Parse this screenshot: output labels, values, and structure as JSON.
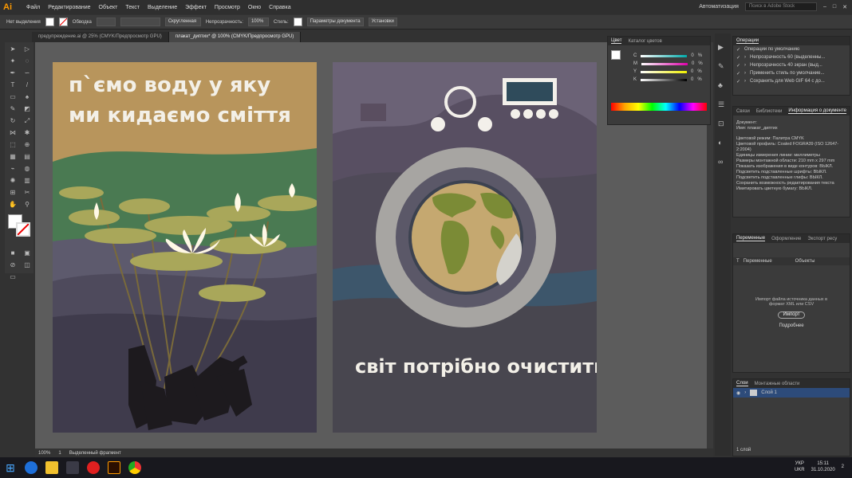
{
  "app": {
    "logo": "Ai",
    "menu": [
      "Файл",
      "Редактирование",
      "Объект",
      "Текст",
      "Выделение",
      "Эффект",
      "Просмотр",
      "Окно",
      "Справка"
    ],
    "workspace": "Автоматизация",
    "search_placeholder": "Поиск в Adobe Stock"
  },
  "control": {
    "selection": "Нет выделения",
    "stroke_label": "Обводка",
    "stroke_brush": "Скругленная",
    "opacity_label": "Непрозрачность:",
    "opacity_value": "100%",
    "style_label": "Стиль:",
    "doc_settings": "Параметры документа",
    "preferences": "Установки"
  },
  "tabs": [
    "предупреждение.ai @ 25% (CMYK/Предпросмотр GPU)",
    "плакат_диптих* @ 100% (CMYK/Предпросмотр GPU)"
  ],
  "poster_left": {
    "line1": "п`ємо воду у яку",
    "line2": "ми кидаємо сміття"
  },
  "poster_right": {
    "slogan": "світ потрібно очистити!"
  },
  "status": {
    "zoom": "100%",
    "page": "1",
    "mode": "Выделенный фрагмент"
  },
  "color_panel": {
    "tabs": [
      "Цвет",
      "Каталог цветов"
    ],
    "channels": [
      {
        "name": "C",
        "value": "0",
        "unit": "%"
      },
      {
        "name": "M",
        "value": "0",
        "unit": "%"
      },
      {
        "name": "Y",
        "value": "0",
        "unit": "%"
      },
      {
        "name": "K",
        "value": "0",
        "unit": "%"
      }
    ]
  },
  "actions_panel": {
    "title": "Операции",
    "set": "Операции по умолчанию",
    "items": [
      "Непрозрачность 60 (выделенны...",
      "Непрозрачность 40 экран (выд...",
      "Применить стиль по умолчание...",
      "Сохранить для Web GIF 64 с до..."
    ]
  },
  "docinfo_panel": {
    "tabs": [
      "Связи",
      "Библиотеки",
      "Информация о документе"
    ],
    "lines": [
      "Документ:",
      "Имя: плакат_диптих",
      "Цветовой режим: Палитра CMYK",
      "Цветовой профиль: Coated FOGRA39 (ISO 12647-2:2004)",
      "Единицы измерения линии: миллиметры",
      "Размеры монтажной области: 210 mm x 297 mm",
      "Показать изображения в виде контуров: ВЫКЛ.",
      "Подсветить подставленные шрифты: ВЫКЛ.",
      "Подсветить подставленные глифы: ВЫКЛ.",
      "Сохранить возможность редактирования текста",
      "Имитировать цветную бумагу: ВЫКЛ."
    ]
  },
  "variables_panel": {
    "tabs": [
      "Переменные",
      "Оформление",
      "Экспорт ресу"
    ],
    "col1": "Переменные",
    "col2": "Объекты",
    "import_hint": "Импорт файла источника данных в формат XML или CSV",
    "import_button": "Импорт",
    "details": "Подробнее"
  },
  "layers_panel": {
    "tabs": [
      "Слои",
      "Монтажные области"
    ],
    "layer": "Слой 1",
    "footer": "1 слой"
  },
  "taskbar": {
    "lang1": "УКР",
    "lang2": "UKR",
    "time": "15:11",
    "date": "31.10.2020",
    "notif": "2"
  }
}
